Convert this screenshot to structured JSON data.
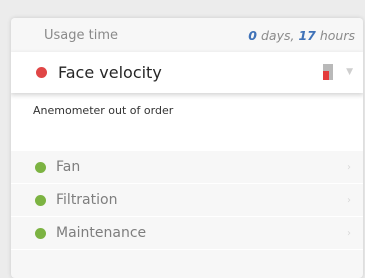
{
  "usage": {
    "label": "Usage time",
    "days_value": "0",
    "days_unit": "days,",
    "hours_value": "17",
    "hours_unit": "hours"
  },
  "header": {
    "title": "Face velocity",
    "status_color": "#e04646",
    "icon": "filter-status-icon",
    "expand_icon": "chevron-down-icon"
  },
  "message": {
    "text": "Anemometer out of order"
  },
  "items": [
    {
      "label": "Fan",
      "status_color": "#7cb342",
      "chevron": "›"
    },
    {
      "label": "Filtration",
      "status_color": "#7cb342",
      "chevron": "›"
    },
    {
      "label": "Maintenance",
      "status_color": "#7cb342",
      "chevron": "›"
    }
  ],
  "colors": {
    "accent_number": "#3f72b8",
    "status_red": "#e04646",
    "status_green": "#7cb342"
  }
}
